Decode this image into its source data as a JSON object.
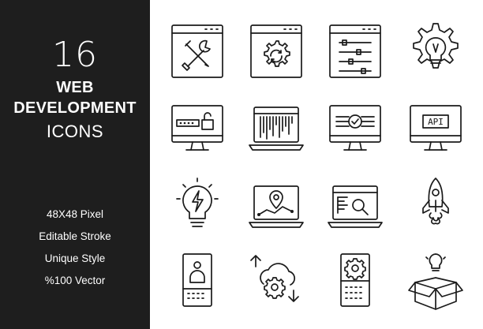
{
  "panel": {
    "count": "16",
    "title_line1": "WEB",
    "title_line2": "DEVELOPMENT",
    "title_line3": "ICONS",
    "features": [
      "48X48 Pixel",
      "Editable Stroke",
      "Unique Style",
      "%100 Vector"
    ]
  },
  "icons": {
    "api_label": "API"
  },
  "colors": {
    "panel_bg": "#1e1e1e",
    "stroke": "#1a1a1a",
    "background": "#ffffff"
  }
}
